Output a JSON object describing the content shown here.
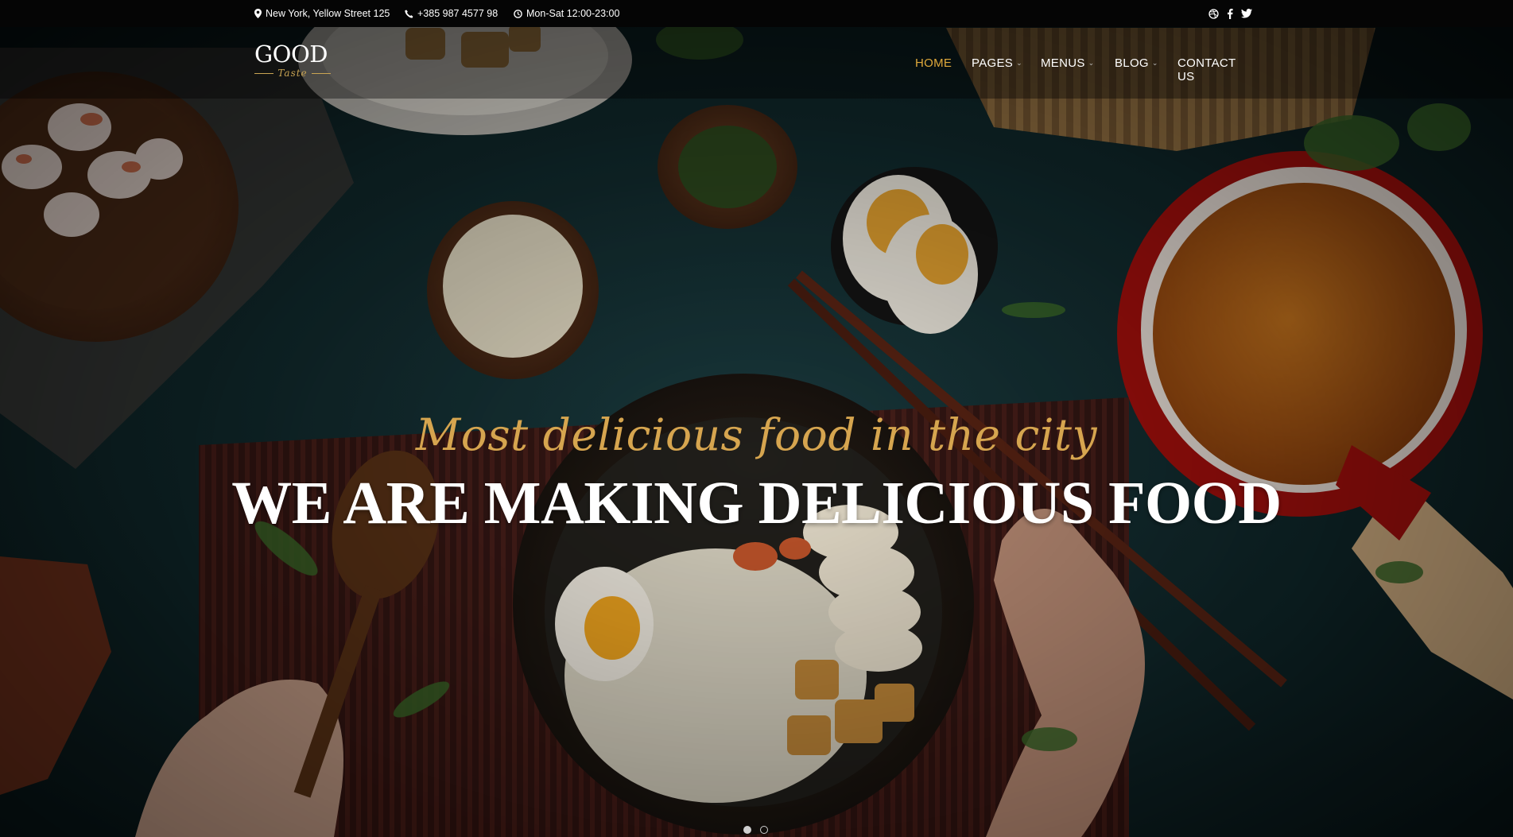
{
  "topbar": {
    "address": "New York, Yellow Street 125",
    "phone": "+385 987 4577 98",
    "hours": "Mon-Sat 12:00-23:00",
    "social": [
      "dribbble-icon",
      "facebook-icon",
      "twitter-icon"
    ]
  },
  "logo": {
    "main": "GOOD",
    "sub": "Taste"
  },
  "nav": {
    "items": [
      {
        "label": "HOME",
        "active": true,
        "dropdown": false
      },
      {
        "label": "PAGES",
        "active": false,
        "dropdown": true
      },
      {
        "label": "MENUS",
        "active": false,
        "dropdown": true
      },
      {
        "label": "BLOG",
        "active": false,
        "dropdown": true
      },
      {
        "label": "CONTACT US",
        "active": false,
        "dropdown": false
      }
    ]
  },
  "hero": {
    "kicker": "Most delicious food in the city",
    "headline": "WE ARE MAKING DELICIOUS FOOD"
  },
  "slider": {
    "slides": 2,
    "active": 1
  },
  "colors": {
    "accent": "#e0a93b",
    "kicker": "#d6a54f",
    "topbar": "#050505"
  }
}
